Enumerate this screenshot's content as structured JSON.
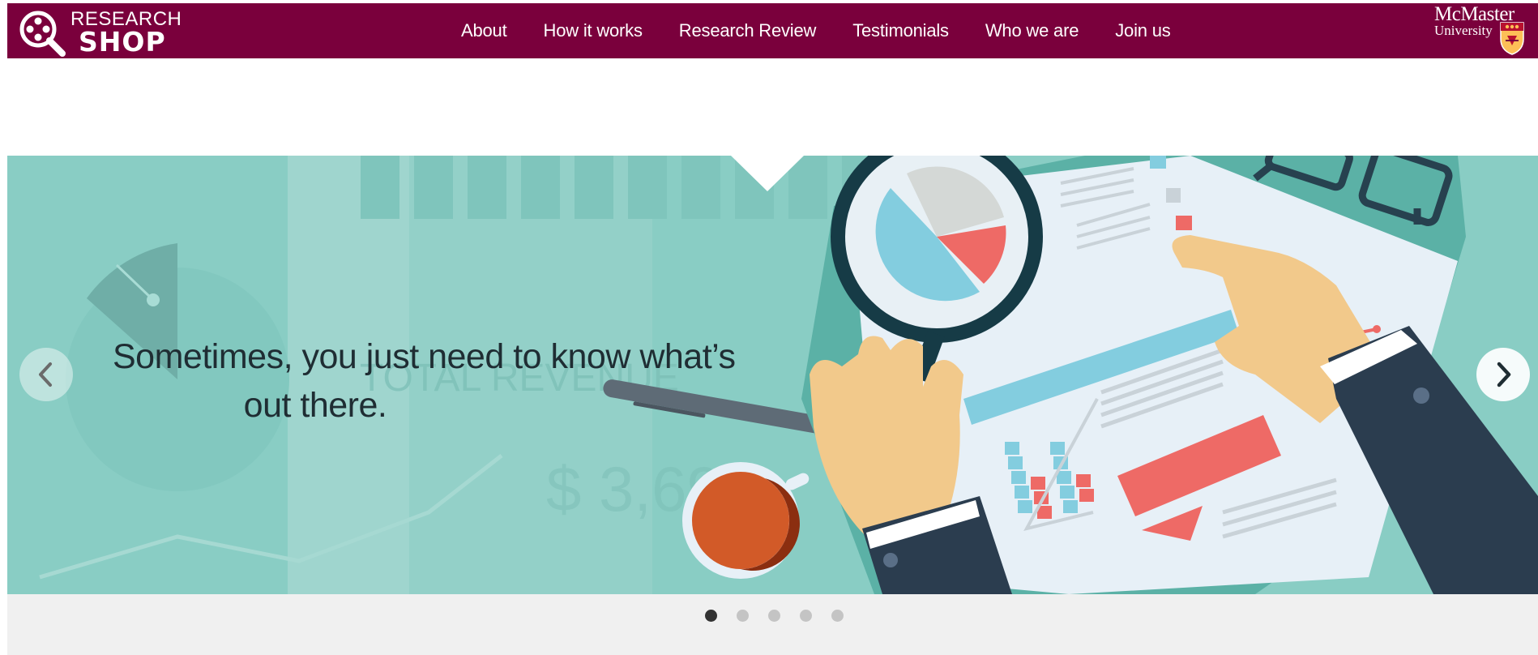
{
  "brand": {
    "logo_line1": "RESEARCH",
    "logo_line2": "SHOP",
    "primary_color": "#7a003c"
  },
  "nav": {
    "items": [
      {
        "label": "About"
      },
      {
        "label": "How it works"
      },
      {
        "label": "Research Review"
      },
      {
        "label": "Testimonials"
      },
      {
        "label": "Who we are"
      },
      {
        "label": "Join us"
      }
    ]
  },
  "university": {
    "name": "McMaster",
    "subtitle": "University"
  },
  "hero": {
    "caption_line1": "Sometimes, you just need to know what’s",
    "caption_line2": "out there.",
    "background_text_label": "TOTAL REVENUE",
    "background_text_value": "$ 3,69",
    "prev_icon": "chevron-left-icon",
    "next_icon": "chevron-right-icon",
    "background_color": "#89cdc4"
  },
  "carousel": {
    "slide_count": 5,
    "active_index": 0
  }
}
